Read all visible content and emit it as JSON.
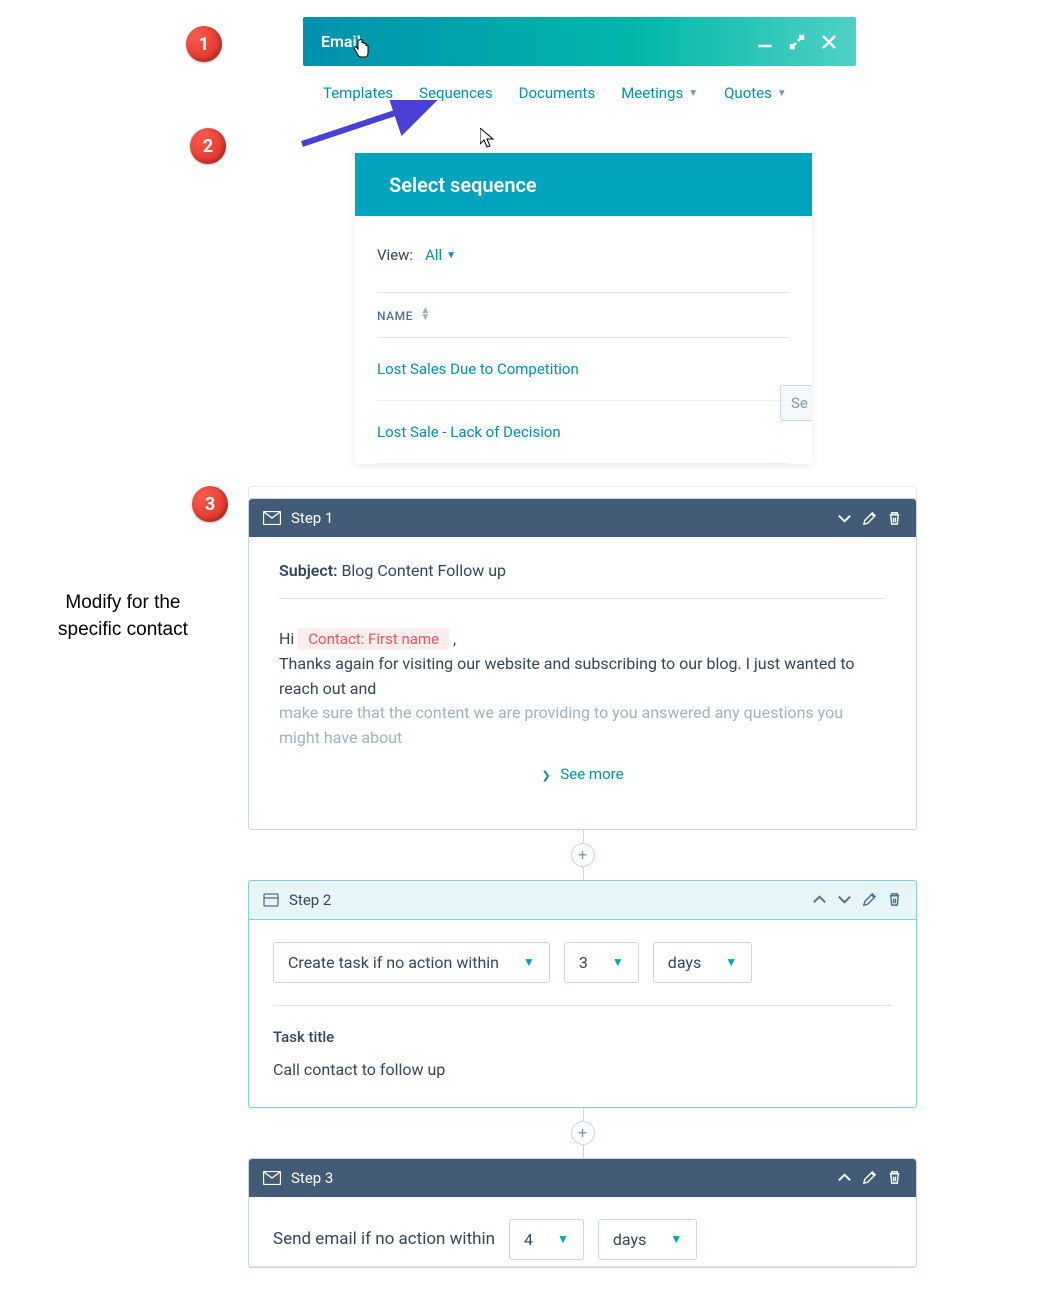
{
  "badges": {
    "one": "1",
    "two": "2",
    "three": "3"
  },
  "emailHeader": {
    "title": "Email"
  },
  "tabs": {
    "templates": "Templates",
    "sequences": "Sequences",
    "documents": "Documents",
    "meetings": "Meetings",
    "quotes": "Quotes"
  },
  "seqModal": {
    "title": "Select sequence",
    "viewLabel": "View:",
    "viewValue": "All",
    "searchPlaceholder": "Se",
    "colName": "NAME",
    "rows": [
      "Lost Sales Due to Competition",
      "Lost Sale - Lack of Decision"
    ]
  },
  "annotation": "Modify for the\nspecific contact",
  "step1": {
    "title": "Step 1",
    "subjectLabel": "Subject:",
    "subjectValue": "Blog Content Follow up",
    "greeting": "Hi ",
    "token": "Contact: First name",
    "comma": " ,",
    "line1": "Thanks again for visiting our website and subscribing to our blog.  I just wanted to reach out and",
    "line2": "make sure that the content we are providing to you answered any questions you might have about",
    "seeMore": "See more"
  },
  "step2": {
    "title": "Step 2",
    "sel1": "Create task if no action within",
    "sel2": "3",
    "sel3": "days",
    "taskLabel": "Task title",
    "taskValue": "Call contact to follow up"
  },
  "step3": {
    "title": "Step 3",
    "label": "Send email if no action within",
    "num": "4",
    "unit": "days"
  }
}
